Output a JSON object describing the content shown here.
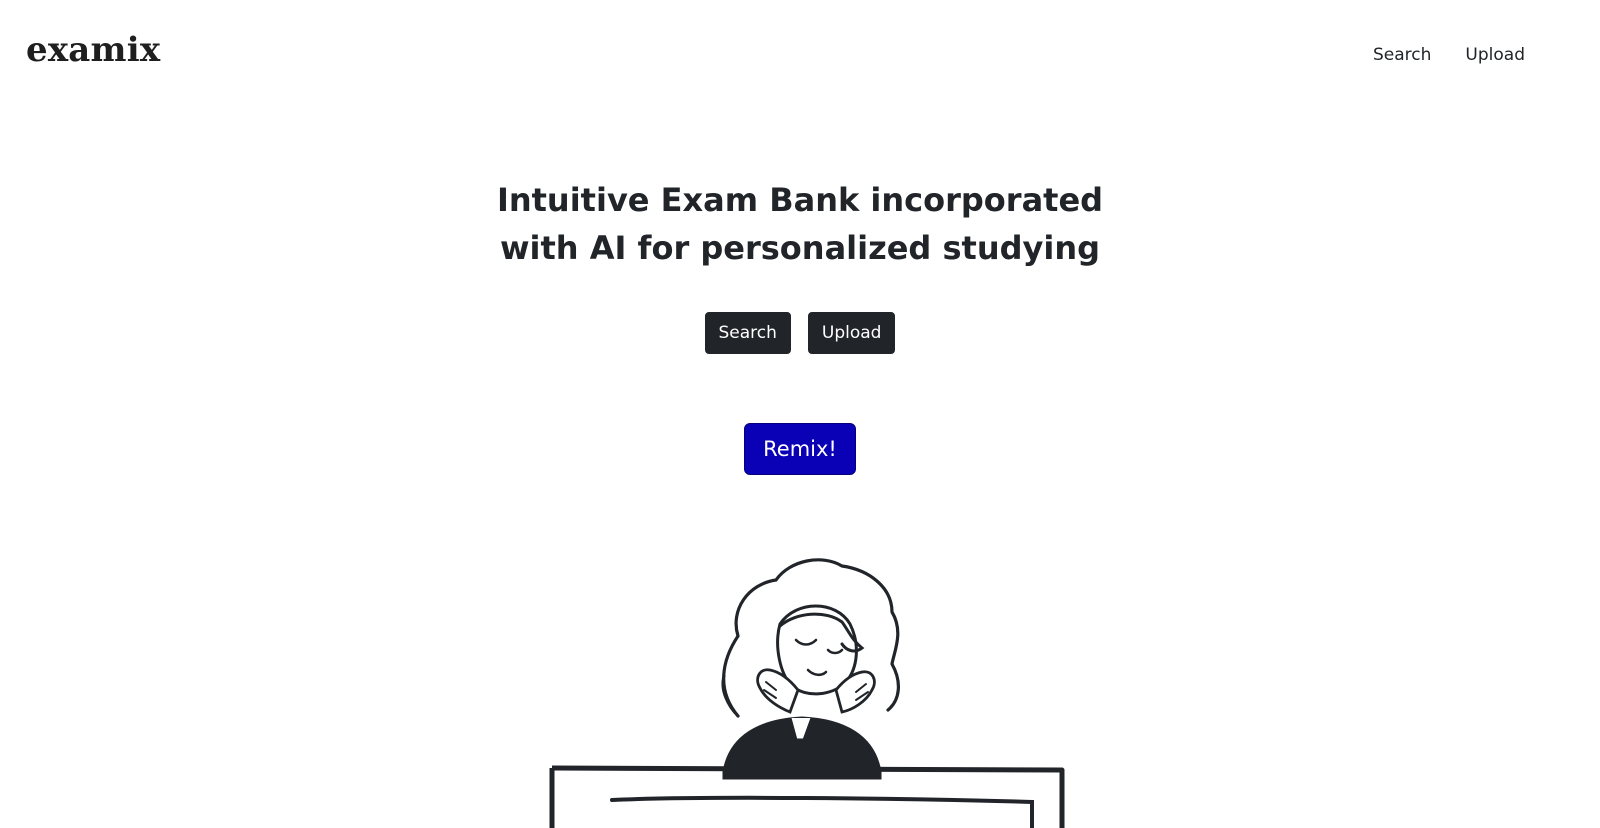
{
  "navbar": {
    "brand": "examix",
    "links": [
      {
        "label": "Search"
      },
      {
        "label": "Upload"
      }
    ]
  },
  "hero": {
    "title_line_1": "Intuitive Exam Bank incorporated",
    "title_line_2": "with AI for personalized studying",
    "search_button": "Search",
    "upload_button": "Upload",
    "remix_button": "Remix!"
  },
  "illustration": {
    "icon": "person-at-desk-illustration"
  },
  "colors": {
    "text": "#212529",
    "dark_button": "#212529",
    "remix_button": "#0a00b6",
    "background": "#ffffff"
  }
}
